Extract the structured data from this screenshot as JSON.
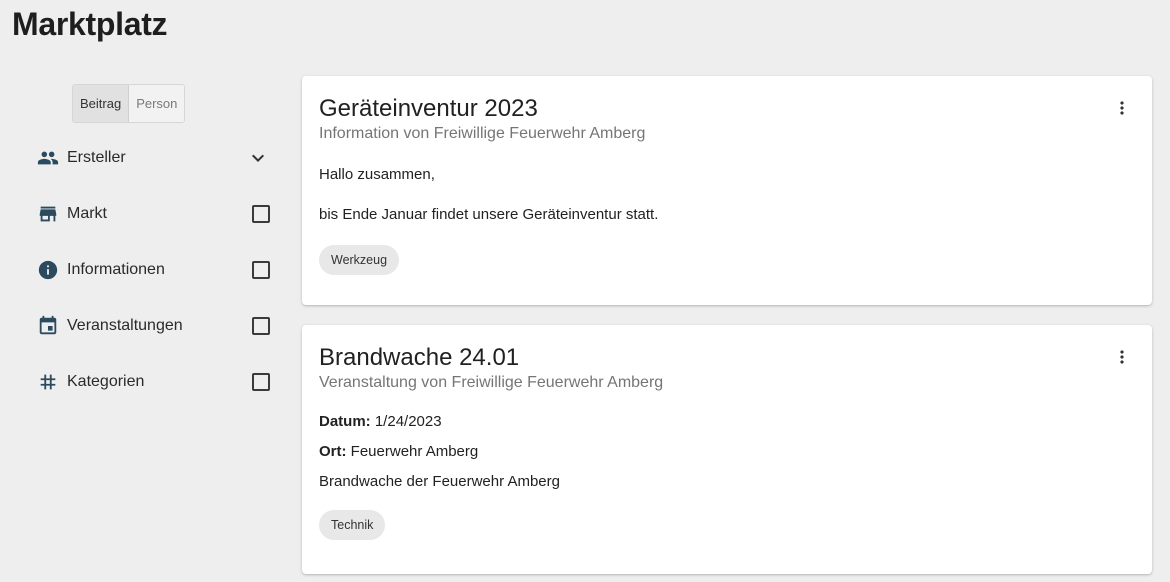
{
  "page": {
    "title": "Marktplatz"
  },
  "toggle": {
    "beitrag": "Beitrag",
    "person": "Person"
  },
  "filters": [
    {
      "label": "Ersteller",
      "icon": "people-icon",
      "control": "chevron-down"
    },
    {
      "label": "Markt",
      "icon": "store-icon",
      "control": "checkbox"
    },
    {
      "label": "Informationen",
      "icon": "info-icon",
      "control": "checkbox"
    },
    {
      "label": "Veranstaltungen",
      "icon": "calendar-icon",
      "control": "checkbox"
    },
    {
      "label": "Kategorien",
      "icon": "hash-icon",
      "control": "checkbox"
    }
  ],
  "cards": [
    {
      "title": "Geräteinventur 2023",
      "subtitle": "Information von Freiwillige Feuerwehr Amberg",
      "lines": [
        "Hallo zusammen,",
        "bis Ende Januar findet unsere Geräteinventur statt."
      ],
      "chip": "Werkzeug"
    },
    {
      "title": "Brandwache 24.01",
      "subtitle": "Veranstaltung von Freiwillige Feuerwehr Amberg",
      "date_label": "Datum:",
      "date_value": "1/24/2023",
      "place_label": "Ort:",
      "place_value": "Feuerwehr Amberg",
      "description": "Brandwache der Feuerwehr Amberg",
      "chip": "Technik"
    }
  ],
  "colors": {
    "background": "#eeeeee",
    "icon": "#2b4a5e",
    "chip": "#e8e8e8"
  }
}
